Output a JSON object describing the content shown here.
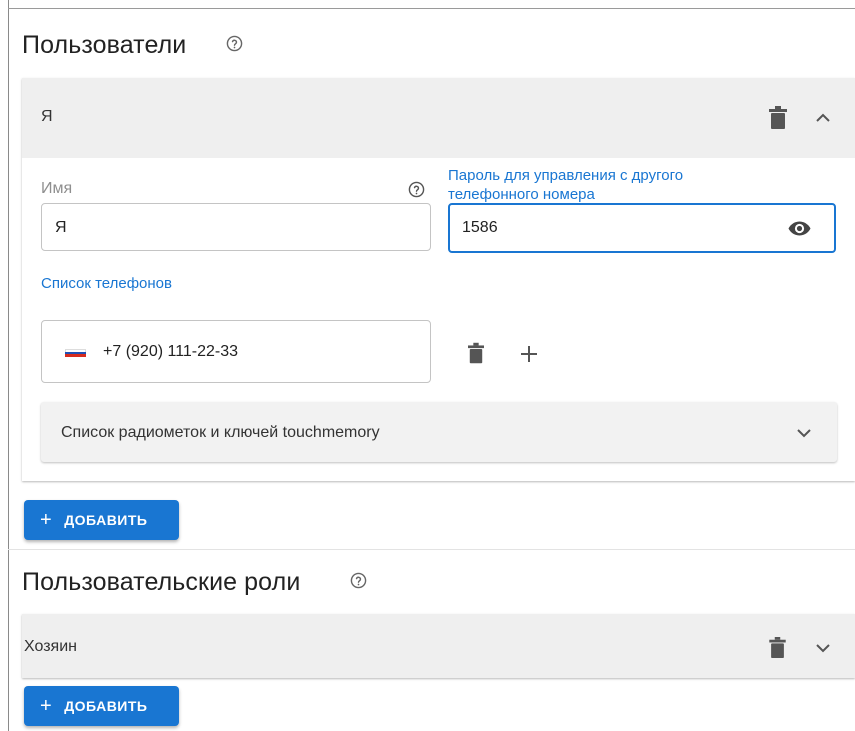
{
  "users_section": {
    "title": "Пользователи",
    "help_icon": "help-circle-icon",
    "user": {
      "name": "Я",
      "name_field": {
        "label": "Имя",
        "value": "Я"
      },
      "password_field": {
        "label_line1": "Пароль для управления с другого",
        "label_line2": "телефонного номера",
        "value": "1586"
      },
      "phones_label": "Список телефонов",
      "phone": {
        "country": "RU",
        "number": "+7 (920) 111-22-33"
      },
      "rfid_label": "Список радиометок и ключей touchmemory"
    },
    "add_button": {
      "icon": "+",
      "label": "ДОБАВИТЬ"
    }
  },
  "roles_section": {
    "title": "Пользовательские роли",
    "help_icon": "help-circle-icon",
    "role": {
      "name": "Хозяин"
    },
    "add_button": {
      "icon": "+",
      "label": "ДОБАВИТЬ"
    }
  },
  "colors": {
    "accent": "#1976d2",
    "header_bg": "#efefef",
    "icon": "#555555",
    "flag_white": "#ffffff",
    "flag_blue": "#1f4fb4",
    "flag_red": "#d52b1e"
  }
}
